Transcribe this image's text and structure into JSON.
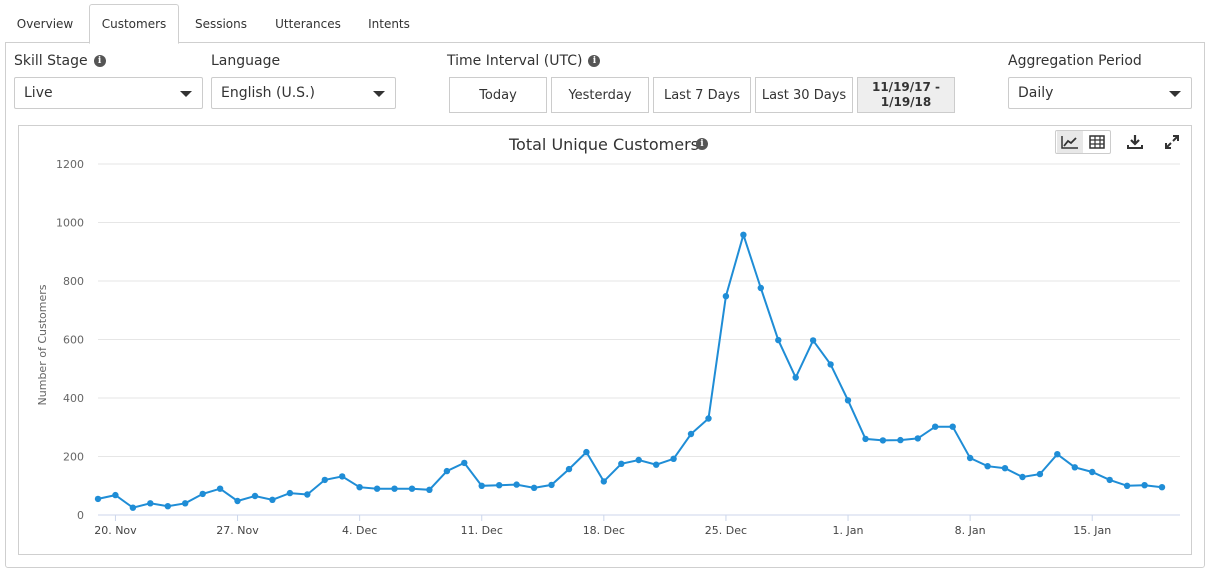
{
  "tabs": [
    {
      "label": "Overview",
      "active": false
    },
    {
      "label": "Customers",
      "active": true
    },
    {
      "label": "Sessions",
      "active": false
    },
    {
      "label": "Utterances",
      "active": false
    },
    {
      "label": "Intents",
      "active": false
    }
  ],
  "filters": {
    "skill_stage": {
      "label": "Skill Stage",
      "value": "Live"
    },
    "language": {
      "label": "Language",
      "value": "English (U.S.)"
    },
    "time_interval": {
      "label": "Time Interval (UTC)",
      "buttons": [
        "Today",
        "Yesterday",
        "Last 7 Days",
        "Last 30 Days"
      ],
      "custom_range_line1": "11/19/17 -",
      "custom_range_line2": "1/19/18"
    },
    "aggregation": {
      "label": "Aggregation Period",
      "value": "Daily"
    }
  },
  "colors": {
    "series": "#1f8dd6",
    "grid": "#e6e6e6",
    "axis": "#ccd6eb"
  },
  "icons": {
    "line_chart": "line-chart-icon",
    "table": "table-icon",
    "download": "download-icon",
    "expand": "expand-icon",
    "info": "info-icon"
  },
  "chart_data": {
    "type": "line",
    "title": "Total Unique Customers",
    "xlabel": "",
    "ylabel": "Number of Customers",
    "ylim": [
      0,
      1200
    ],
    "y_ticks": [
      "0",
      "200",
      "400",
      "600",
      "800",
      "1000",
      "1200"
    ],
    "x_tick_labels": [
      "20. Nov",
      "27. Nov",
      "4. Dec",
      "11. Dec",
      "18. Dec",
      "25. Dec",
      "1. Jan",
      "8. Jan",
      "15. Jan"
    ],
    "x_start_date": "2017-11-19",
    "grid": true,
    "legend": "none",
    "series": [
      {
        "values": [
          55,
          68,
          25,
          40,
          30,
          40,
          72,
          90,
          48,
          65,
          52,
          75,
          70,
          120,
          132,
          95,
          90,
          90,
          90,
          86,
          150,
          178,
          100,
          102,
          104,
          93,
          103,
          157,
          215,
          115,
          175,
          188,
          172,
          192,
          277,
          330,
          748,
          958,
          776,
          598,
          470,
          597,
          515,
          392,
          260,
          255,
          256,
          262,
          302,
          302,
          195,
          167,
          160,
          130,
          140,
          208,
          163,
          147,
          120,
          100,
          102,
          95
        ]
      }
    ]
  }
}
